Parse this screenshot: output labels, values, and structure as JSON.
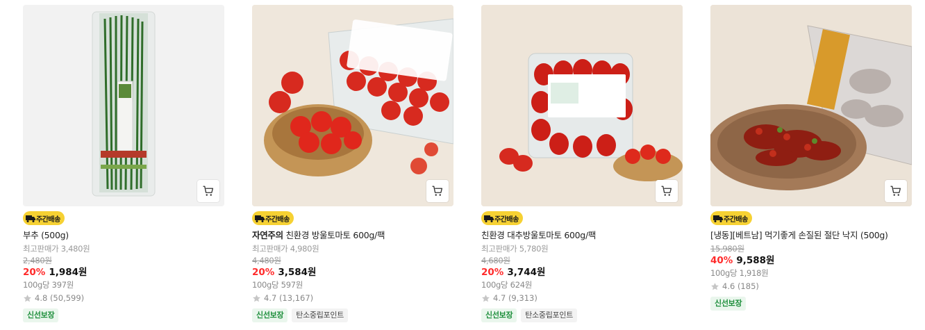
{
  "products": [
    {
      "badge": "주간배송",
      "brand": "",
      "title": "부추 (500g)",
      "ref_price": "최고판매가 3,480원",
      "orig_price": "2,480원",
      "discount": "20%",
      "price": "1,984원",
      "unit_price": "100g당 397원",
      "rating": "4.8 (50,599)",
      "tags": [
        "신선보장"
      ]
    },
    {
      "badge": "주간배송",
      "brand": "자연주의",
      "title": " 친환경 방울토마토 600g/팩",
      "ref_price": "최고판매가 4,980원",
      "orig_price": "4,480원",
      "discount": "20%",
      "price": "3,584원",
      "unit_price": "100g당 597원",
      "rating": "4.7 (13,167)",
      "tags": [
        "신선보장",
        "탄소중립포인트"
      ]
    },
    {
      "badge": "주간배송",
      "brand": "",
      "title": "친환경 대추방울토마토 600g/팩",
      "ref_price": "최고판매가 5,780원",
      "orig_price": "4,680원",
      "discount": "20%",
      "price": "3,744원",
      "unit_price": "100g당 624원",
      "rating": "4.7 (9,313)",
      "tags": [
        "신선보장",
        "탄소중립포인트"
      ]
    },
    {
      "badge": "주간배송",
      "brand": "",
      "title": "[냉동][베트남] 먹기좋게 손질된 절단 낙지 (500g)",
      "ref_price": "",
      "orig_price": "15,980원",
      "discount": "40%",
      "price": "9,588원",
      "unit_price": "100g당 1,918원",
      "rating": "4.6 (185)",
      "tags": [
        "신선보장"
      ]
    }
  ],
  "icons": {
    "cart": "cart-icon",
    "star": "star-icon",
    "truck": "truck-icon"
  },
  "colors": {
    "discount": "#ff2b2b",
    "badge_bg": "#f6d133",
    "fresh_tag": "#1e8f3c"
  }
}
